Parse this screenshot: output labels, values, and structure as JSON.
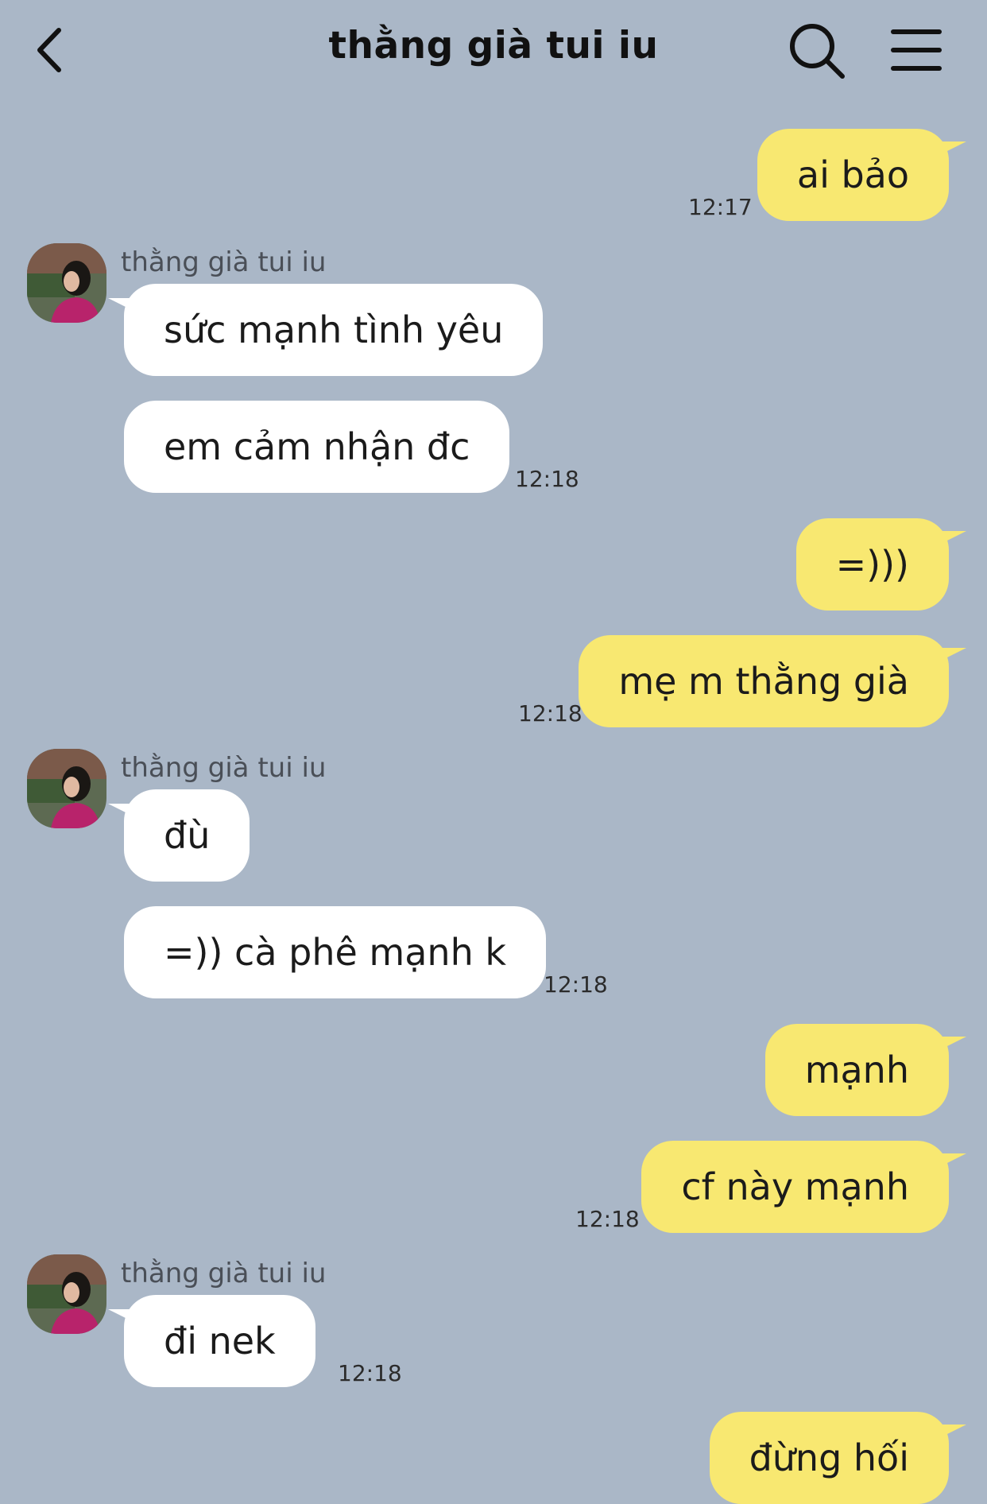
{
  "header": {
    "title": "thằng già tui iu",
    "back_icon": "chevron-left-icon",
    "search_icon": "search-icon",
    "menu_icon": "hamburger-menu-icon"
  },
  "colors": {
    "background": "#aab7c7",
    "outgoing_bubble": "#f8e871",
    "incoming_bubble": "#ffffff"
  },
  "contact": {
    "name": "thằng già tui iu"
  },
  "messages": [
    {
      "dir": "out",
      "text": "ai bảo",
      "time": "12:17"
    },
    {
      "dir": "in",
      "text": "sức mạnh tình yêu"
    },
    {
      "dir": "in",
      "text": "em cảm nhận đc",
      "time": "12:18"
    },
    {
      "dir": "out",
      "text": "=)))"
    },
    {
      "dir": "out",
      "text": "mẹ m thằng già",
      "time": "12:18"
    },
    {
      "dir": "in",
      "text": "đù"
    },
    {
      "dir": "in",
      "text": "=)) cà phê mạnh k",
      "time": "12:18"
    },
    {
      "dir": "out",
      "text": "mạnh"
    },
    {
      "dir": "out",
      "text": "cf này mạnh",
      "time": "12:18"
    },
    {
      "dir": "in",
      "text": "đi nek",
      "time": "12:18"
    },
    {
      "dir": "out",
      "text": "đừng hối"
    }
  ]
}
